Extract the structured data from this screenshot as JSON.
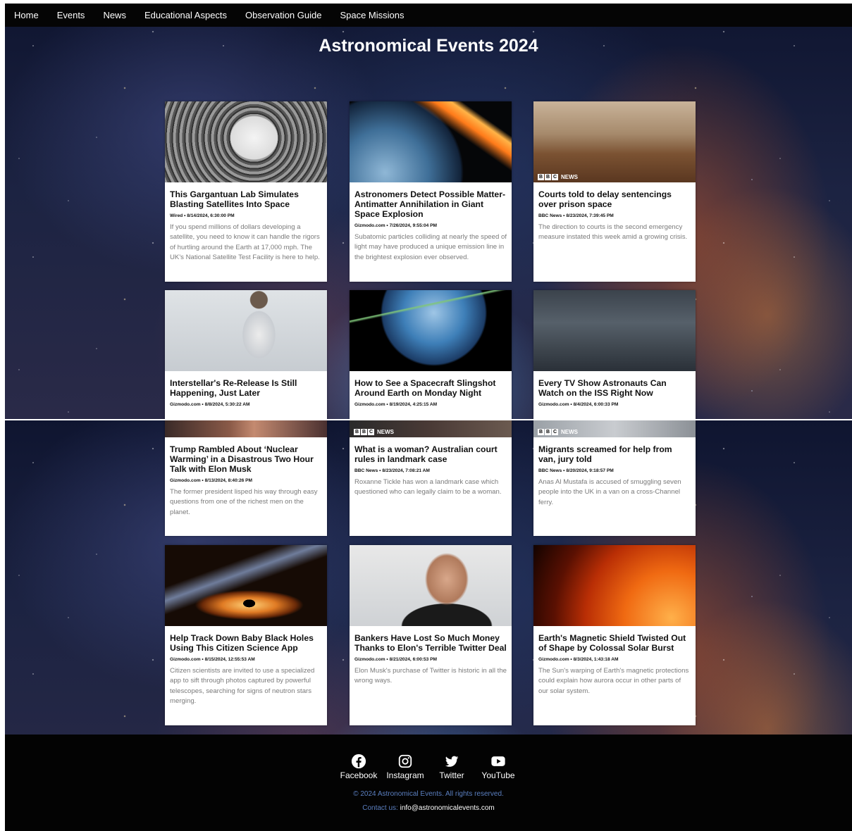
{
  "nav": [
    "Home",
    "Events",
    "News",
    "Educational Aspects",
    "Observation Guide",
    "Space Missions"
  ],
  "page_title": "Astronomical Events 2024",
  "badge": {
    "b1": "B",
    "b2": "B",
    "b3": "C",
    "news": "NEWS"
  },
  "cards": [
    {
      "title": "This Gargantuan Lab Simulates Blasting Satellites Into Space",
      "meta": "Wired • 8/14/2024, 6:30:00 PM",
      "desc": "If you spend millions of dollars developing a satellite, you need to know it can handle the rigors of hurtling around the Earth at 17,000 mph. The UK's National Satellite Test Facility is here to help."
    },
    {
      "title": "Astronomers Detect Possible Matter-Antimatter Annihilation in Giant Space Explosion",
      "meta": "Gizmodo.com • 7/26/2024, 9:55:04 PM",
      "desc": "Subatomic particles colliding at nearly the speed of light may have produced a unique emission line in the brightest explosion ever observed."
    },
    {
      "title": "Courts told to delay sentencings over prison space",
      "meta": "BBC News • 8/23/2024, 7:39:45 PM",
      "desc": "The direction to courts is the second emergency measure instated this week amid a growing crisis."
    },
    {
      "title": "Interstellar's Re-Release Is Still Happening, Just Later",
      "meta": "Gizmodo.com • 8/8/2024, 5:30:22 AM",
      "desc": ""
    },
    {
      "title": "How to See a Spacecraft Slingshot Around Earth on Monday Night",
      "meta": "Gizmodo.com • 8/19/2024, 4:25:15 AM",
      "desc": ""
    },
    {
      "title": "Every TV Show Astronauts Can Watch on the ISS Right Now",
      "meta": "Gizmodo.com • 8/4/2024, 6:00:33 PM",
      "desc": ""
    },
    {
      "title": "Trump Rambled About ‘Nuclear Warming’ in a Disastrous Two Hour Talk with Elon Musk",
      "meta": "Gizmodo.com • 8/13/2024, 8:40:26 PM",
      "desc": "The former president lisped his way through easy questions from one of the richest men on the planet."
    },
    {
      "title": "What is a woman? Australian court rules in landmark case",
      "meta": "BBC News • 8/23/2024, 7:08:21 AM",
      "desc": "Roxanne Tickle has won a landmark case which questioned who can legally claim to be a woman."
    },
    {
      "title": "Migrants screamed for help from van, jury told",
      "meta": "BBC News • 8/20/2024, 9:18:57 PM",
      "desc": "Anas Al Mustafa is accused of smuggling seven people into the UK in a van on a cross-Channel ferry."
    },
    {
      "title": "Help Track Down Baby Black Holes Using This Citizen Science App",
      "meta": "Gizmodo.com • 8/15/2024, 12:55:53 AM",
      "desc": "Citizen scientists are invited to use a specialized app to sift through photos captured by powerful telescopes, searching for signs of neutron stars merging."
    },
    {
      "title": "Bankers Have Lost So Much Money Thanks to Elon's Terrible Twitter Deal",
      "meta": "Gizmodo.com • 8/21/2024, 6:00:53 PM",
      "desc": "Elon Musk's purchase of Twitter is historic in all the wrong ways."
    },
    {
      "title": "Earth's Magnetic Shield Twisted Out of Shape by Colossal Solar Burst",
      "meta": "Gizmodo.com • 8/3/2024, 1:43:18 AM",
      "desc": "The Sun's warping of Earth's magnetic protections could explain how aurora occur in other parts of our solar system."
    }
  ],
  "footer": {
    "social": [
      "Facebook",
      "Instagram",
      "Twitter",
      "YouTube"
    ],
    "copyright": "© 2024 Astronomical Events. All rights reserved.",
    "contact_label": "Contact us:",
    "contact_email": "info@astronomicalevents.com"
  }
}
